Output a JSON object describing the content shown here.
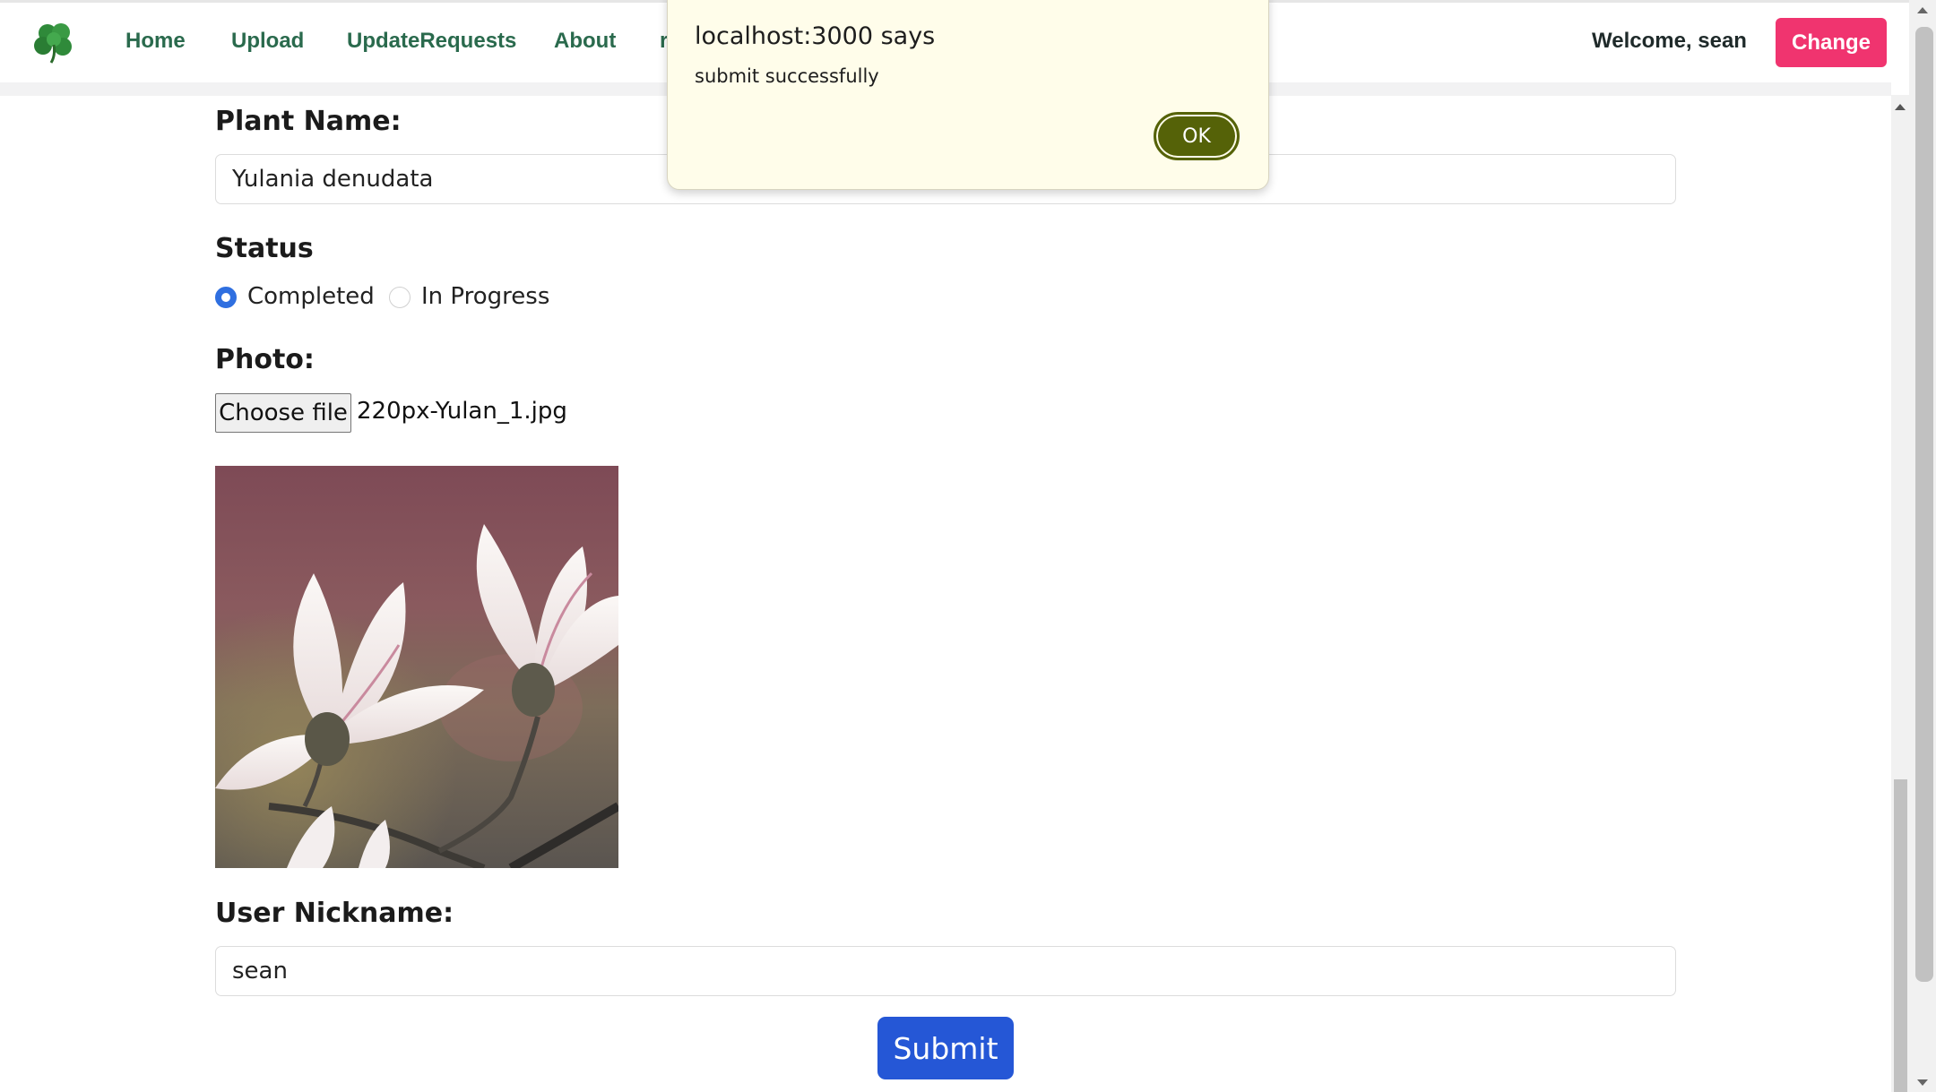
{
  "navbar": {
    "links": [
      "Home",
      "Upload",
      "UpdateRequests",
      "About",
      "r"
    ],
    "welcome": "Welcome, sean",
    "change_label": "Change"
  },
  "form": {
    "plant_name_label": "Plant Name:",
    "plant_name_value": "Yulania denudata",
    "status_label": "Status",
    "status_options": [
      {
        "label": "Completed",
        "checked": true
      },
      {
        "label": "In Progress",
        "checked": false
      }
    ],
    "photo_label": "Photo:",
    "choose_file_label": "Choose file",
    "file_name": "220px-Yulan_1.jpg",
    "nickname_label": "User Nickname:",
    "nickname_value": "sean",
    "submit_label": "Submit"
  },
  "dialog": {
    "title": "localhost:3000 says",
    "message": "submit successfully",
    "ok_label": "OK"
  },
  "colors": {
    "nav_link": "#2a6a4d",
    "change_button": "#f0346f",
    "submit_button": "#2557d6",
    "radio_checked": "#2f6fe0",
    "dialog_bg": "#fffdea",
    "ok_button": "#556208"
  },
  "icons": {
    "logo": "clover-icon"
  }
}
